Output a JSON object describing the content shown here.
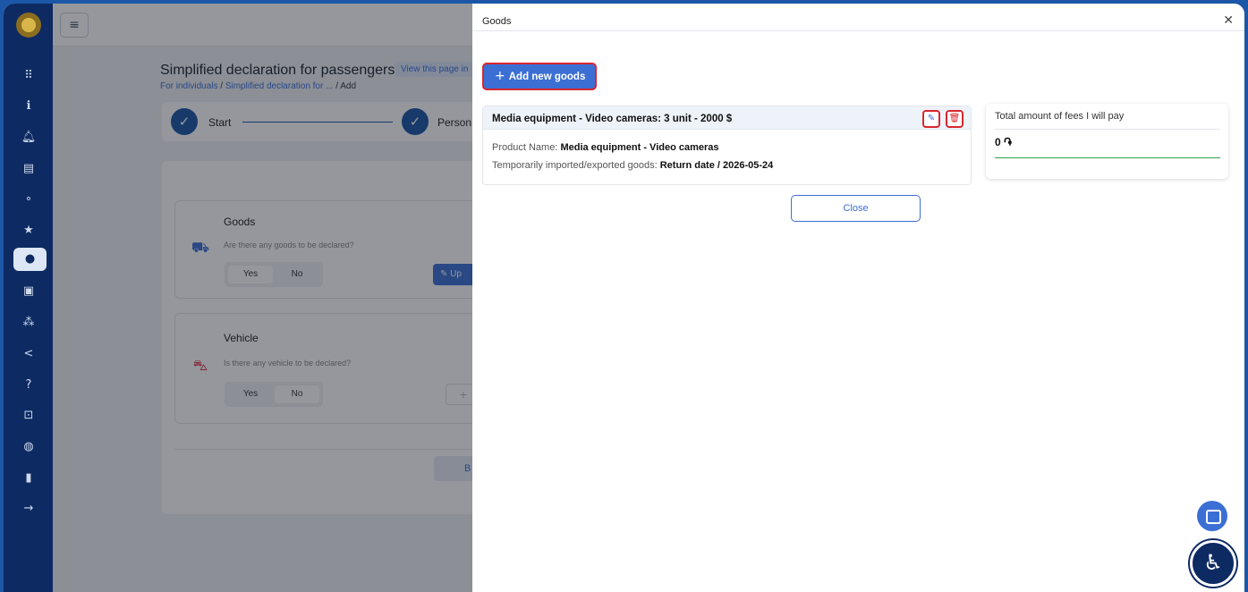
{
  "page": {
    "title": "Simplified declaration for passengers",
    "view_link": "View this page in",
    "breadcrumb": [
      "For individuals",
      "Simplified declaration for ...",
      "Add"
    ],
    "steps": [
      "Start",
      "Person"
    ],
    "goods_section": {
      "title": "Goods",
      "question": "Are there any goods to be declared?",
      "yes": "Yes",
      "no": "No",
      "update_label": "Up"
    },
    "vehicle_section": {
      "title": "Vehicle",
      "question": "Is there any vehicle to be declared?",
      "yes": "Yes",
      "no": "No"
    },
    "back_label": "B"
  },
  "drawer": {
    "title": "Goods",
    "add_button": "Add new goods",
    "goods_item": {
      "title": "Media equipment - Video cameras: 3 unit - 2000 $",
      "product_name_label": "Product Name:",
      "product_name_value": "Media equipment - Video cameras",
      "temp_label": "Temporarily imported/exported goods:",
      "temp_value": "Return date / 2026-05-24"
    },
    "fees": {
      "label": "Total amount of fees I will pay",
      "value": "0 ֏"
    },
    "close_button": "Close"
  },
  "icons": {
    "sidebar": [
      "apps-icon",
      "info-icon",
      "bell-icon",
      "document-icon",
      "route-icon",
      "star-icon",
      "user-icon",
      "briefcase-icon",
      "group-icon",
      "share-icon",
      "help-icon",
      "lock-icon",
      "chat-icon",
      "stats-icon",
      "logout-icon"
    ]
  },
  "colors": {
    "primary": "#3b6fd4",
    "navy": "#0d2a63",
    "danger": "#d9262f",
    "success": "#2aa44d"
  }
}
